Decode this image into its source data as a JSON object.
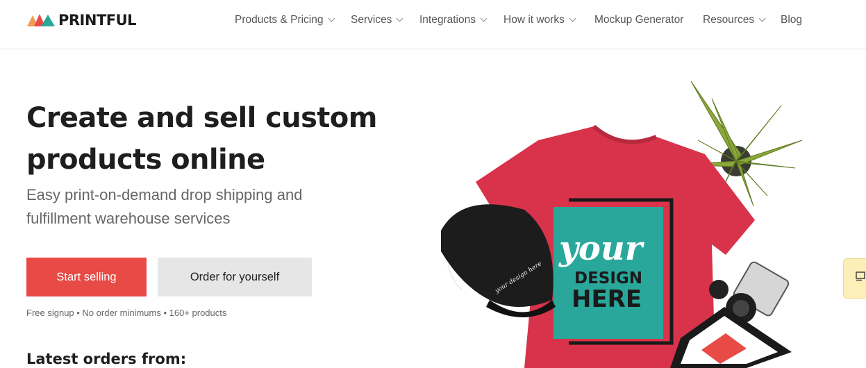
{
  "brand": {
    "name": "PRINTFUL",
    "colors": {
      "red": "#e84a45",
      "teal": "#2aa79b",
      "orange": "#f29a57",
      "dark": "#1a1a1a"
    }
  },
  "nav": {
    "items": [
      {
        "label": "Products & Pricing",
        "dropdown": true
      },
      {
        "label": "Services",
        "dropdown": true
      },
      {
        "label": "Integrations",
        "dropdown": true
      },
      {
        "label": "How it works",
        "dropdown": true
      },
      {
        "label": "Mockup Generator",
        "dropdown": false
      },
      {
        "label": "Resources",
        "dropdown": true
      },
      {
        "label": "Blog",
        "dropdown": false
      }
    ]
  },
  "hero": {
    "title_line1": "Create and sell custom",
    "title_line2": "products online",
    "subtitle_line1": "Easy print-on-demand drop shipping and",
    "subtitle_line2": "fulfillment warehouse services",
    "primary_cta": "Start selling",
    "secondary_cta": "Order for yourself",
    "fine_print": "Free signup • No order minimums • 160+ products",
    "image": {
      "description_icons": [
        "t-shirt",
        "cap",
        "plant",
        "camera",
        "frame"
      ],
      "shirt_text_line1": "your",
      "shirt_text_line2": "DESIGN",
      "shirt_text_line3": "HERE",
      "cap_text": "your design here"
    }
  },
  "section": {
    "latest_orders": "Latest orders from:"
  },
  "widgets": {
    "chat_icon": "chat-icon"
  }
}
